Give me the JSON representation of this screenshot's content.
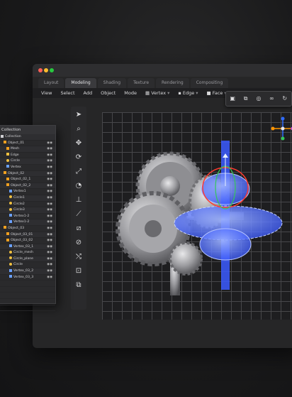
{
  "app": {
    "tabs": [
      "Layout",
      "Modeling",
      "Shading",
      "Texture",
      "Rendering",
      "Compositing"
    ],
    "active_tab": "Modeling"
  },
  "menubar": {
    "items": [
      "View",
      "Select",
      "Add",
      "Object",
      "Mode"
    ],
    "vertex_label": "Vertex",
    "edge_label": "Edge",
    "face_label": "Face"
  },
  "outliner": {
    "title": "Collection",
    "items": [
      {
        "label": "Collection",
        "indent": 0,
        "icon": "collection"
      },
      {
        "label": "Object_01",
        "indent": 1,
        "icon": "object"
      },
      {
        "label": "Mesh",
        "indent": 2,
        "icon": "mesh"
      },
      {
        "label": "Edge",
        "indent": 2,
        "icon": "edge"
      },
      {
        "label": "Circle",
        "indent": 2,
        "icon": "circle"
      },
      {
        "label": "Vertex",
        "indent": 2,
        "icon": "vertex"
      },
      {
        "label": "Object_02",
        "indent": 1,
        "icon": "object"
      },
      {
        "label": "Object_02_1",
        "indent": 2,
        "icon": "object"
      },
      {
        "label": "Object_02_2",
        "indent": 2,
        "icon": "object"
      },
      {
        "label": "Vertex1",
        "indent": 3,
        "icon": "vertex"
      },
      {
        "label": "Circle1",
        "indent": 3,
        "icon": "circle"
      },
      {
        "label": "Circle2",
        "indent": 3,
        "icon": "circle"
      },
      {
        "label": "Circle3",
        "indent": 3,
        "icon": "circle"
      },
      {
        "label": "Vertex1-2",
        "indent": 3,
        "icon": "vertex"
      },
      {
        "label": "Vertex1-2",
        "indent": 3,
        "icon": "vertex"
      },
      {
        "label": "Object_03",
        "indent": 1,
        "icon": "object"
      },
      {
        "label": "Object_03_01",
        "indent": 2,
        "icon": "object"
      },
      {
        "label": "Object_03_02",
        "indent": 2,
        "icon": "object"
      },
      {
        "label": "Vertex_03_1",
        "indent": 3,
        "icon": "vertex"
      },
      {
        "label": "Circle_mesh",
        "indent": 3,
        "icon": "circle"
      },
      {
        "label": "Circle_plane",
        "indent": 3,
        "icon": "circle"
      },
      {
        "label": "Circle",
        "indent": 3,
        "icon": "circle"
      },
      {
        "label": "Vertex_03_2",
        "indent": 3,
        "icon": "vertex"
      },
      {
        "label": "Vertex_03_3",
        "indent": 3,
        "icon": "vertex"
      }
    ]
  },
  "colors": {
    "accent": "#4a6cff",
    "gizmo_red": "#ff3b30",
    "gizmo_green": "#34c759",
    "gizmo_blue": "#2f6bff",
    "traffic_red": "#ff5f57",
    "traffic_yellow": "#febc2e",
    "traffic_green": "#28c840",
    "object_icon": "#f0a020"
  },
  "viewport": {
    "grid": true
  }
}
